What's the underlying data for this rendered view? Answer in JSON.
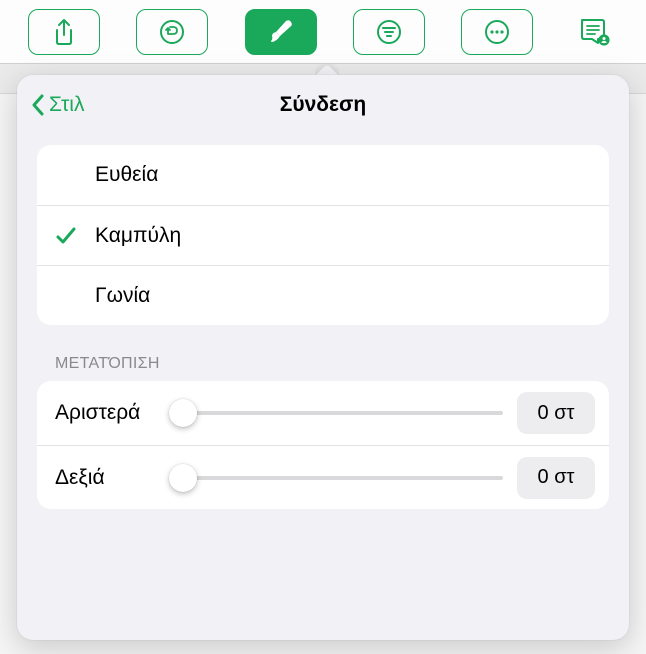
{
  "toolbar": {
    "icons": [
      "share-icon",
      "undo-icon",
      "format-brush-icon",
      "list-icon",
      "more-icon",
      "presenter-icon"
    ],
    "active_index": 2
  },
  "popover": {
    "back_label": "Στιλ",
    "title": "Σύνδεση",
    "options": [
      {
        "label": "Ευθεία",
        "selected": false
      },
      {
        "label": "Καμπύλη",
        "selected": true
      },
      {
        "label": "Γωνία",
        "selected": false
      }
    ],
    "offset_section_title": "ΜΕΤΑΤΌΠΙΣΗ",
    "offsets": [
      {
        "label": "Αριστερά",
        "value_display": "0 στ",
        "slider_percent": 0
      },
      {
        "label": "Δεξιά",
        "value_display": "0 στ",
        "slider_percent": 0
      }
    ]
  },
  "colors": {
    "accent": "#1aa85b"
  }
}
